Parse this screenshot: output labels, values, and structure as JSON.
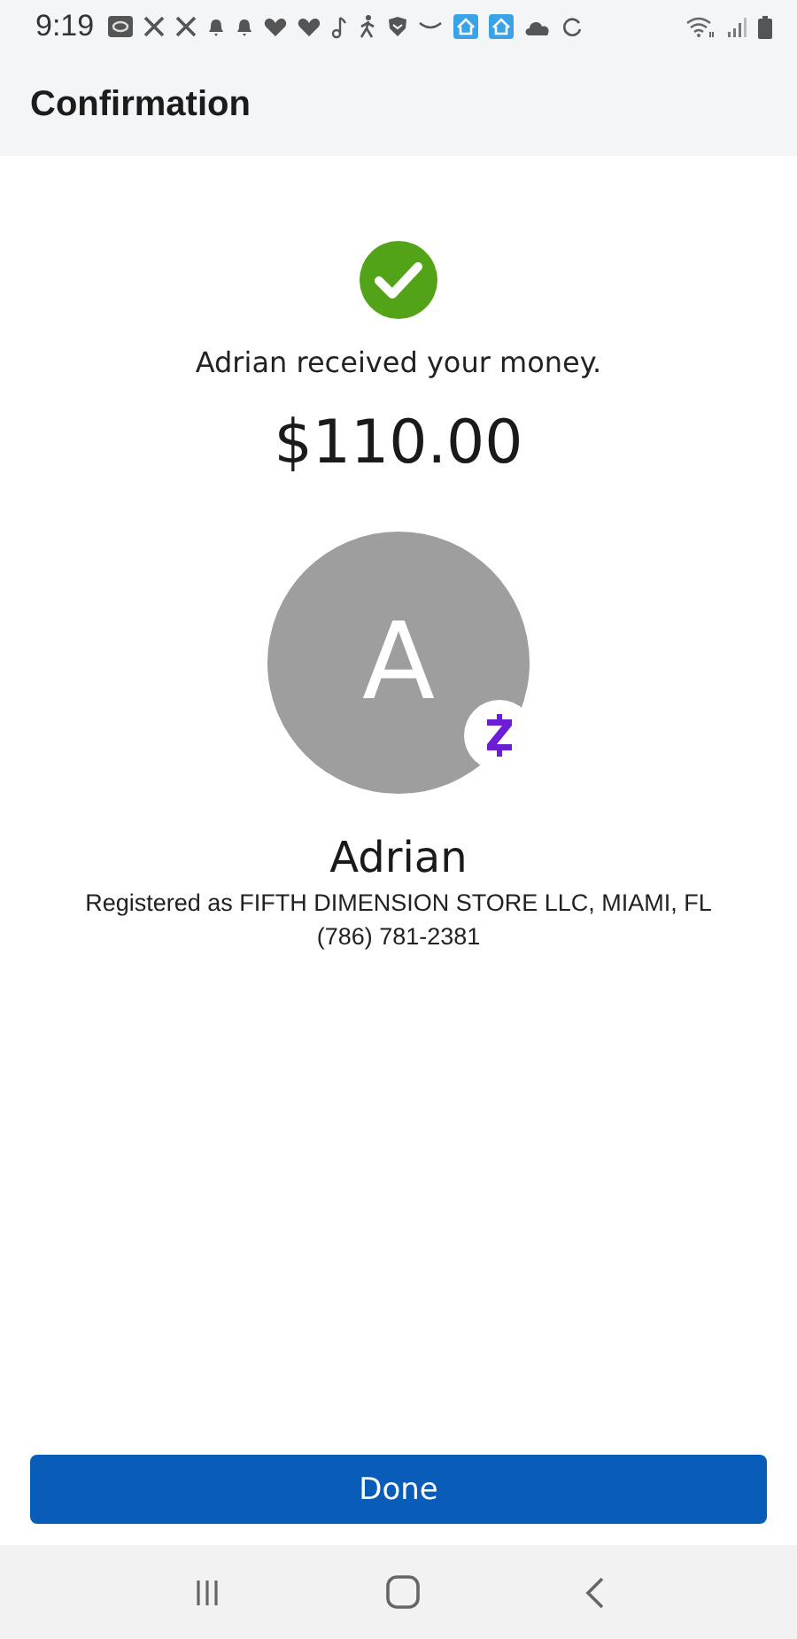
{
  "status_bar": {
    "time": "9:19"
  },
  "header": {
    "title": "Confirmation"
  },
  "confirmation": {
    "message": "Adrian received your money.",
    "amount": "$110.00"
  },
  "recipient": {
    "initial": "A",
    "name": "Adrian",
    "registered_as": "Registered as FIFTH DIMENSION STORE LLC, MIAMI, FL",
    "phone": "(786) 781-2381"
  },
  "buttons": [
    {
      "label": "Done"
    }
  ]
}
